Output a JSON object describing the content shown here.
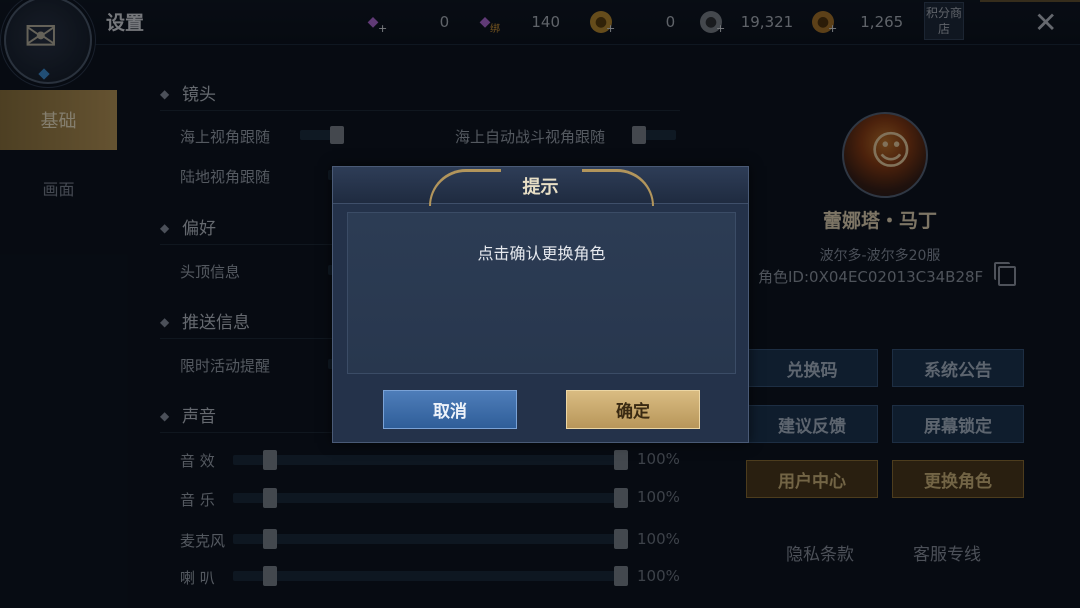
{
  "header": {
    "title": "设置",
    "currencies": [
      {
        "icon": "purple-gem-icon",
        "value": "0"
      },
      {
        "icon": "bound-purple-gem-icon",
        "value": "140",
        "tag": "绑"
      },
      {
        "icon": "gold-coin-icon",
        "value": "0"
      },
      {
        "icon": "silver-coin-icon",
        "value": "19,321"
      },
      {
        "icon": "copper-coin-icon",
        "value": "1,265"
      }
    ],
    "points_shop": "积分商店",
    "close_glyph": "✕"
  },
  "nav": {
    "basic": "基础",
    "screen": "画面"
  },
  "settings": {
    "camera": {
      "title": "镜头",
      "sea_follow": "海上视角跟随",
      "auto_battle_follow": "海上自动战斗视角跟随",
      "land_follow": "陆地视角跟随"
    },
    "preference": {
      "title": "偏好",
      "head_info": "头顶信息"
    },
    "push": {
      "title": "推送信息",
      "event_reminder": "限时活动提醒"
    },
    "sound": {
      "title": "声音",
      "items": [
        {
          "label": "音 效",
          "value": "100%"
        },
        {
          "label": "音 乐",
          "value": "100%"
        },
        {
          "label": "麦克风",
          "value": "100%"
        },
        {
          "label": "喇 叭",
          "value": "100%"
        }
      ]
    }
  },
  "profile": {
    "name": "蕾娜塔・马丁",
    "server": "波尔多-波尔多20服",
    "role_id_label": "角色ID:",
    "role_id": "0X04EC02013C34B28F",
    "buttons": {
      "redeem": "兑换码",
      "announce": "系统公告",
      "feedback": "建议反馈",
      "lock": "屏幕锁定",
      "user_center": "用户中心",
      "switch_role": "更换角色"
    },
    "privacy": "隐私条款",
    "support": "客服专线"
  },
  "dialog": {
    "title": "提示",
    "message": "点击确认更换角色",
    "cancel": "取消",
    "confirm": "确定"
  }
}
